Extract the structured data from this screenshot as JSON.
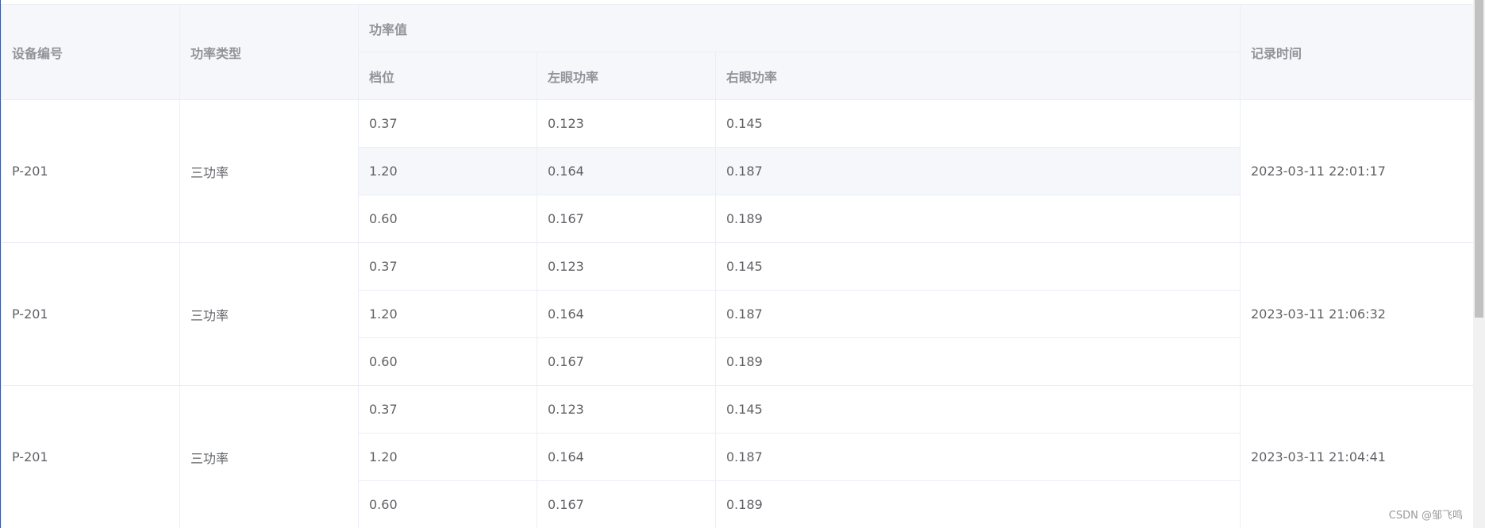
{
  "table": {
    "headers": {
      "device_id": "设备编号",
      "power_type": "功率类型",
      "power_value": "功率值",
      "level": "档位",
      "left_eye": "左眼功率",
      "right_eye": "右眼功率",
      "record_time": "记录时间"
    },
    "groups": [
      {
        "device_id": "P-201",
        "power_type": "三功率",
        "record_time": "2023-03-11 22:01:17",
        "rows": [
          {
            "level": "0.37",
            "left": "0.123",
            "right": "0.145"
          },
          {
            "level": "1.20",
            "left": "0.164",
            "right": "0.187"
          },
          {
            "level": "0.60",
            "left": "0.167",
            "right": "0.189"
          }
        ]
      },
      {
        "device_id": "P-201",
        "power_type": "三功率",
        "record_time": "2023-03-11 21:06:32",
        "rows": [
          {
            "level": "0.37",
            "left": "0.123",
            "right": "0.145"
          },
          {
            "level": "1.20",
            "left": "0.164",
            "right": "0.187"
          },
          {
            "level": "0.60",
            "left": "0.167",
            "right": "0.189"
          }
        ]
      },
      {
        "device_id": "P-201",
        "power_type": "三功率",
        "record_time": "2023-03-11 21:04:41",
        "rows": [
          {
            "level": "0.37",
            "left": "0.123",
            "right": "0.145"
          },
          {
            "level": "1.20",
            "left": "0.164",
            "right": "0.187"
          },
          {
            "level": "0.60",
            "left": "0.167",
            "right": "0.189"
          }
        ]
      }
    ]
  },
  "watermark": "CSDN @邹飞鸣",
  "colors": {
    "header_bg": "#f5f7fa",
    "header_text": "#909399",
    "cell_text": "#606266",
    "border": "#ebeef5"
  }
}
